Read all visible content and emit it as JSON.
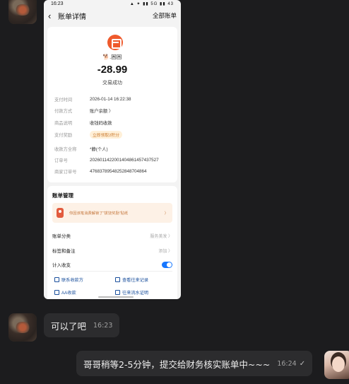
{
  "chat": {
    "image_message": {
      "phone": {
        "statusbar": {
          "time": "16:23",
          "icons": "▲ ✦ ▮▮ 5G ▮▮ 43"
        },
        "navbar": {
          "title": "账单详情",
          "all_bills": "全部账单"
        },
        "summary": {
          "merchant": "🐕.困困",
          "amount": "-28.99",
          "status": "交易成功"
        },
        "details": [
          {
            "key": "支付时间",
            "value": "2026-01-14 16:22:38"
          },
          {
            "key": "付款方式",
            "value": "账户余额 〉"
          },
          {
            "key": "商品说明",
            "value": "收钱码收款"
          },
          {
            "key": "支付奖励",
            "value": "立即领取2积分"
          },
          {
            "key": "收款方全称",
            "value": "*静(个人)"
          },
          {
            "key": "订单号",
            "value": "20260114220014048614574375​27"
          },
          {
            "key": "商家订单号",
            "value": "4768378954825284870486​4"
          }
        ],
        "manage": {
          "title": "账单管理",
          "banner_text": "你因该笔消费解锁了\"拔饶奖励\"贴纸",
          "banner_arrow": "〉",
          "rows": [
            {
              "label": "账单分类",
              "value": "服务美发 〉"
            },
            {
              "label": "标签和备注",
              "value": "添加 〉"
            },
            {
              "label": "计入收支",
              "value": ""
            }
          ],
          "actions": [
            "联系收款方",
            "查看往来记录",
            "AA收款",
            "往来流水证明"
          ]
        }
      }
    },
    "message_in": {
      "text": "可以了吧",
      "time": "16:23"
    },
    "message_out": {
      "text": "哥哥稍等2-5分钟，提交给财务核实账单中~~~",
      "time": "16:24",
      "read_mark": "✓"
    }
  }
}
